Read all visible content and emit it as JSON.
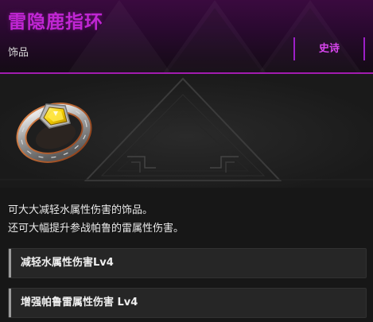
{
  "item": {
    "name": "雷隐鹿指环",
    "category": "饰品",
    "rarity": "史诗",
    "rarity_color": "#d946ef",
    "title_color": "#c026d3",
    "icon": "ring-icon"
  },
  "description": {
    "line1": "可大大减轻水属性伤害的饰品。",
    "line2": "还可大幅提升参战帕鲁的雷属性伤害。"
  },
  "skills": [
    {
      "label": "减轻水属性伤害Lv4"
    },
    {
      "label": "增强帕鲁雷属性伤害 Lv4"
    }
  ]
}
